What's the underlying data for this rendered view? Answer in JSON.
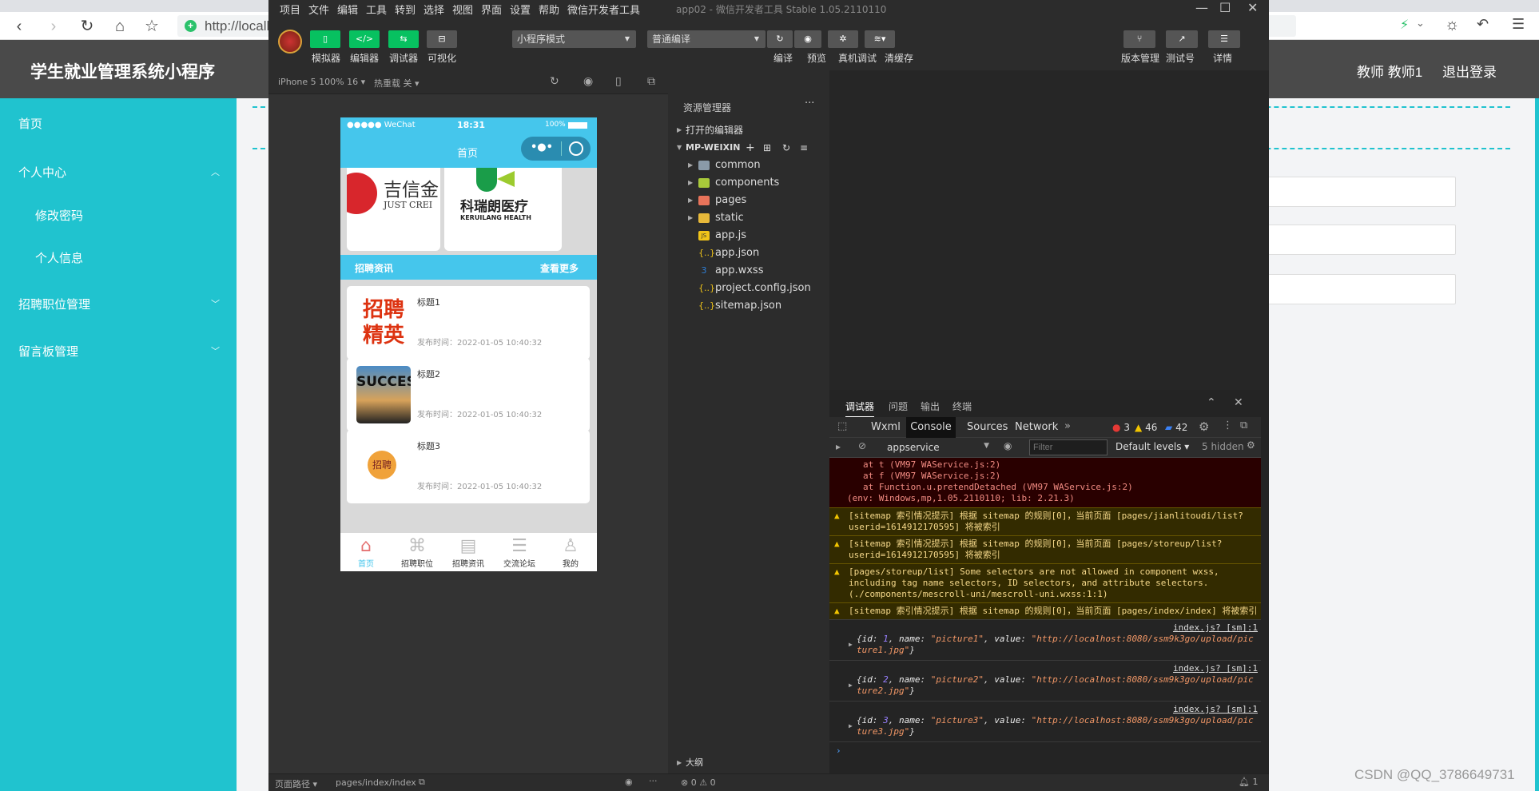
{
  "browser": {
    "url": "http://localh",
    "icons": [
      "back-icon",
      "forward-icon",
      "reload-icon",
      "home-icon",
      "star-icon",
      "shield-icon",
      "bolt-icon",
      "chevron-down-icon",
      "brightness-icon",
      "undo-icon",
      "menu-icon"
    ]
  },
  "webapp": {
    "title": "学生就业管理系统小程序",
    "user": "教师 教师1",
    "logout": "退出登录",
    "sidebar": [
      {
        "label": "首页",
        "sub": false,
        "chevron": ""
      },
      {
        "label": "个人中心",
        "sub": false,
        "chevron": "up"
      },
      {
        "label": "修改密码",
        "sub": true,
        "chevron": ""
      },
      {
        "label": "个人信息",
        "sub": true,
        "chevron": ""
      },
      {
        "label": "招聘职位管理",
        "sub": false,
        "chevron": "down"
      },
      {
        "label": "留言板管理",
        "sub": false,
        "chevron": "down"
      }
    ],
    "accent": "#20c3cf",
    "watermark": "CSDN @QQ_3786649731"
  },
  "devtools": {
    "menu": [
      "项目",
      "文件",
      "编辑",
      "工具",
      "转到",
      "选择",
      "视图",
      "界面",
      "设置",
      "帮助",
      "微信开发者工具"
    ],
    "window_title": "app02 - 微信开发者工具 Stable 1.05.2110110",
    "toolbar": {
      "simulator": "模拟器",
      "editor": "编辑器",
      "debugger": "调试器",
      "visual": "可视化",
      "mode": "小程序模式",
      "compile_mode": "普通编译",
      "compile": "编译",
      "preview": "预览",
      "remote_debug": "真机调试",
      "clear_cache": "清缓存",
      "version": "版本管理",
      "test_account": "测试号",
      "details": "详情"
    },
    "sim_bar": {
      "device": "iPhone 5 100% 16",
      "hot_reload": "热重载 关"
    },
    "phone": {
      "status_left": "●●●●● WeChat",
      "time": "18:31",
      "battery": "100%",
      "nav_title": "首页",
      "banners": [
        {
          "logo_text": "吉信金",
          "logo_sub": "JUST CREI"
        },
        {
          "logo_text": "科瑞朗医疗",
          "logo_sub": "KERUILANG HEALTH"
        }
      ],
      "section_title": "招聘资讯",
      "section_more": "查看更多",
      "news": [
        {
          "title": "标题1",
          "time": "发布时间：2022-01-05 10:40:32",
          "thumb_text": "招聘精英"
        },
        {
          "title": "标题2",
          "time": "发布时间：2022-01-05 10:40:32",
          "thumb_text": "SUCCES"
        },
        {
          "title": "标题3",
          "time": "发布时间：2022-01-05 10:40:32",
          "thumb_text": "招聘"
        }
      ],
      "tabs": [
        "首页",
        "招聘职位",
        "招聘资讯",
        "交流论坛",
        "我的"
      ],
      "tab_active": "#45c6ec",
      "header_color": "#45c6ec"
    },
    "explorer": {
      "title": "资源管理器",
      "open_editors": "打开的编辑器",
      "project": "MP-WEIXIN",
      "files": [
        {
          "name": "common",
          "type": "folder",
          "color": "#8a9aa8"
        },
        {
          "name": "components",
          "type": "folder",
          "color": "#a8c93a"
        },
        {
          "name": "pages",
          "type": "folder",
          "color": "#e8735a"
        },
        {
          "name": "static",
          "type": "folder",
          "color": "#e8b93a"
        },
        {
          "name": "app.js",
          "type": "js",
          "color": "#f0c419"
        },
        {
          "name": "app.json",
          "type": "json",
          "color": "#f0c419"
        },
        {
          "name": "app.wxss",
          "type": "css",
          "color": "#2f7fd6"
        },
        {
          "name": "project.config.json",
          "type": "json",
          "color": "#f0c419"
        },
        {
          "name": "sitemap.json",
          "type": "json",
          "color": "#f0c419"
        }
      ],
      "outline": "大纲"
    },
    "console": {
      "panel_tabs": [
        "调试器",
        "问题",
        "输出",
        "终端"
      ],
      "tabs": [
        "Wxml",
        "Console",
        "Sources",
        "Network"
      ],
      "active_tab": "Console",
      "errors": "3",
      "warnings": "46",
      "infos": "42",
      "context": "appservice",
      "filter_placeholder": "Filter",
      "levels": "Default levels",
      "hidden": "5 hidden",
      "error_lines": [
        "at t (VM97 WAService.js:2)",
        "at f (VM97 WAService.js:2)",
        "at Function.u.pretendDetached (VM97 WAService.js:2)",
        "(env: Windows,mp,1.05.2110110; lib: 2.21.3)"
      ],
      "warnings_list": [
        "[sitemap 索引情况提示] 根据 sitemap 的规则[0]，当前页面 [pages/jianlitoudi/list?userid=1614912170595] 将被索引",
        "[sitemap 索引情况提示] 根据 sitemap 的规则[0]，当前页面 [pages/storeup/list?userid=1614912170595] 将被索引",
        "[pages/storeup/list] Some selectors are not allowed in component wxss, including tag name selectors, ID selectors, and attribute selectors.(./components/mescroll-uni/mescroll-uni.wxss:1:1)",
        "[sitemap 索引情况提示] 根据 sitemap 的规则[0]，当前页面 [pages/index/index] 将被索引"
      ],
      "logs": [
        {
          "src": "index.js? [sm]:1",
          "id": "1",
          "name": "\"picture1\"",
          "value": "\"http://localhost:8080/ssm9k3go/upload/picture1.jpg\""
        },
        {
          "src": "index.js? [sm]:1",
          "id": "2",
          "name": "\"picture2\"",
          "value": "\"http://localhost:8080/ssm9k3go/upload/picture2.jpg\""
        },
        {
          "src": "index.js? [sm]:1",
          "id": "3",
          "name": "\"picture3\"",
          "value": "\"http://localhost:8080/ssm9k3go/upload/picture3.jpg\""
        }
      ],
      "prompt": "›"
    },
    "status": {
      "path_label": "页面路径",
      "path": "pages/index/index",
      "errors": "0",
      "warnings": "0",
      "bell_count": "1"
    }
  }
}
